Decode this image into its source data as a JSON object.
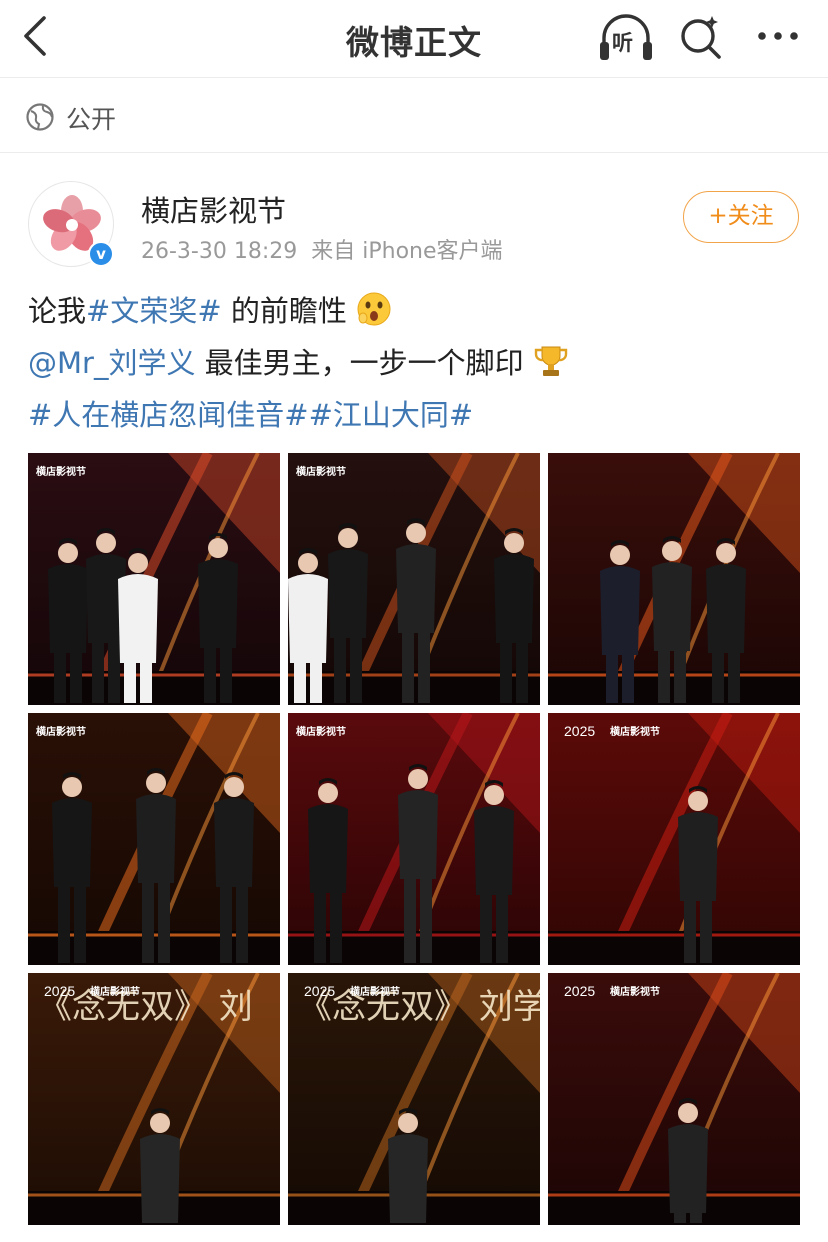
{
  "header": {
    "title": "微博正文",
    "listen_label": "听"
  },
  "visibility": {
    "label": "公开"
  },
  "post": {
    "username": "横店影视节",
    "time": "26-3-30 18:29",
    "source": "来自 iPhone客户端",
    "follow_label": "+关注",
    "verified_badge": "v",
    "text": {
      "l1_a": "论我",
      "l1_tag": "#文荣奖#",
      "l1_b": " 的前瞻性",
      "l2_mention": "@Mr_刘学义",
      "l2_b": " 最佳男主，一步一个脚印",
      "l3_tag1": "#人在横店忽闻佳音#",
      "l3_tag2": "#江山大同#"
    }
  },
  "photos": [
    {
      "logo": "横店影视节",
      "year": "",
      "banner": ""
    },
    {
      "logo": "横店影视节",
      "year": "",
      "banner": ""
    },
    {
      "logo": "",
      "year": "",
      "banner": ""
    },
    {
      "logo": "横店影视节",
      "year": "",
      "banner": ""
    },
    {
      "logo": "横店影视节",
      "year": "",
      "banner": ""
    },
    {
      "logo": "横店影视节",
      "year": "2025",
      "banner": ""
    },
    {
      "logo": "横店影视节",
      "year": "2025",
      "banner": "《念无双》 刘"
    },
    {
      "logo": "横店影视节",
      "year": "2025",
      "banner": "《念无双》 刘学"
    },
    {
      "logo": "横店影视节",
      "year": "2025",
      "banner": ""
    }
  ],
  "colors": {
    "link": "#3f77b3",
    "follow": "#f08c1a",
    "verified": "#2a8ee8"
  }
}
